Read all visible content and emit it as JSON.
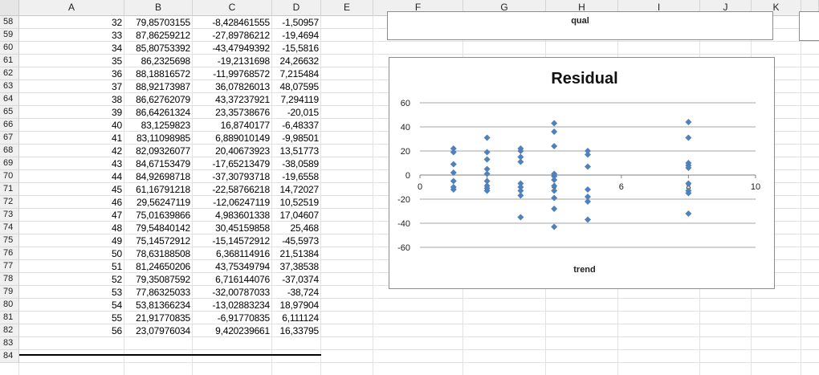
{
  "columns": [
    "A",
    "B",
    "C",
    "D",
    "E",
    "F",
    "G",
    "H",
    "I",
    "J",
    "K"
  ],
  "rows": [
    {
      "num": "58",
      "a": "32",
      "b": "79,85703155",
      "c": "-8,428461555",
      "d": "-1,50957"
    },
    {
      "num": "59",
      "a": "33",
      "b": "87,86259212",
      "c": "-27,89786212",
      "d": "-19,4694"
    },
    {
      "num": "60",
      "a": "34",
      "b": "85,80753392",
      "c": "-43,47949392",
      "d": "-15,5816"
    },
    {
      "num": "61",
      "a": "35",
      "b": "86,2325698",
      "c": "-19,2131698",
      "d": "24,26632"
    },
    {
      "num": "62",
      "a": "36",
      "b": "88,18816572",
      "c": "-11,99768572",
      "d": "7,215484"
    },
    {
      "num": "63",
      "a": "37",
      "b": "88,92173987",
      "c": "36,07826013",
      "d": "48,07595"
    },
    {
      "num": "64",
      "a": "38",
      "b": "86,62762079",
      "c": "43,37237921",
      "d": "7,294119"
    },
    {
      "num": "65",
      "a": "39",
      "b": "86,64261324",
      "c": "23,35738676",
      "d": "-20,015"
    },
    {
      "num": "66",
      "a": "40",
      "b": "83,1259823",
      "c": "16,8740177",
      "d": "-6,48337"
    },
    {
      "num": "67",
      "a": "41",
      "b": "83,11098985",
      "c": "6,889010149",
      "d": "-9,98501"
    },
    {
      "num": "68",
      "a": "42",
      "b": "82,09326077",
      "c": "20,40673923",
      "d": "13,51773"
    },
    {
      "num": "69",
      "a": "43",
      "b": "84,67153479",
      "c": "-17,65213479",
      "d": "-38,0589"
    },
    {
      "num": "70",
      "a": "44",
      "b": "84,92698718",
      "c": "-37,30793718",
      "d": "-19,6558"
    },
    {
      "num": "71",
      "a": "45",
      "b": "61,16791218",
      "c": "-22,58766218",
      "d": "14,72027"
    },
    {
      "num": "72",
      "a": "46",
      "b": "29,56247119",
      "c": "-12,06247119",
      "d": "10,52519"
    },
    {
      "num": "73",
      "a": "47",
      "b": "75,01639866",
      "c": "4,983601338",
      "d": "17,04607"
    },
    {
      "num": "74",
      "a": "48",
      "b": "79,54840142",
      "c": "30,45159858",
      "d": "25,468"
    },
    {
      "num": "75",
      "a": "49",
      "b": "75,14572912",
      "c": "-15,14572912",
      "d": "-45,5973"
    },
    {
      "num": "76",
      "a": "50",
      "b": "78,63188508",
      "c": "6,368114916",
      "d": "21,51384"
    },
    {
      "num": "77",
      "a": "51",
      "b": "81,24650206",
      "c": "43,75349794",
      "d": "37,38538"
    },
    {
      "num": "78",
      "a": "52",
      "b": "79,35087592",
      "c": "6,716144076",
      "d": "-37,0374"
    },
    {
      "num": "79",
      "a": "53",
      "b": "77,86325033",
      "c": "-32,00787033",
      "d": "-38,724"
    },
    {
      "num": "80",
      "a": "54",
      "b": "53,81366234",
      "c": "-13,02883234",
      "d": "18,97904"
    },
    {
      "num": "81",
      "a": "55",
      "b": "21,91770835",
      "c": "-6,91770835",
      "d": "6,111124"
    },
    {
      "num": "82",
      "a": "56",
      "b": "23,07976034",
      "c": "9,420239661",
      "d": "16,33795"
    },
    {
      "num": "83",
      "a": "",
      "b": "",
      "c": "",
      "d": ""
    },
    {
      "num": "84",
      "a": "",
      "b": "",
      "c": "",
      "d": ""
    }
  ],
  "top_chart": {
    "xlabel": "qual"
  },
  "chart_data": {
    "type": "scatter",
    "title": "Residual",
    "xlabel": "trend",
    "ylabel": "",
    "xlim": [
      0,
      10
    ],
    "ylim": [
      -60,
      60
    ],
    "x_ticks": [
      "0",
      "2",
      "4",
      "6",
      "8",
      "10"
    ],
    "y_ticks": [
      "60",
      "40",
      "20",
      "0",
      "-20",
      "-40",
      "-60"
    ],
    "grid": "horizontal",
    "marker_color": "#4f81bd",
    "points": [
      [
        1,
        22
      ],
      [
        1,
        19
      ],
      [
        1,
        9
      ],
      [
        1,
        2
      ],
      [
        1,
        -5
      ],
      [
        1,
        -10
      ],
      [
        1,
        -12
      ],
      [
        2,
        31
      ],
      [
        2,
        19
      ],
      [
        2,
        13
      ],
      [
        2,
        5
      ],
      [
        2,
        1
      ],
      [
        2,
        -5
      ],
      [
        2,
        -9
      ],
      [
        2,
        -11
      ],
      [
        2,
        -13
      ],
      [
        3,
        22
      ],
      [
        3,
        20
      ],
      [
        3,
        15
      ],
      [
        3,
        11
      ],
      [
        3,
        -7
      ],
      [
        3,
        -10
      ],
      [
        3,
        -13
      ],
      [
        3,
        -17
      ],
      [
        3,
        -35
      ],
      [
        4,
        43
      ],
      [
        4,
        36
      ],
      [
        4,
        24
      ],
      [
        4,
        1
      ],
      [
        4,
        -1
      ],
      [
        4,
        -4
      ],
      [
        4,
        -9
      ],
      [
        4,
        -13
      ],
      [
        4,
        -19
      ],
      [
        4,
        -28
      ],
      [
        4,
        -43
      ],
      [
        5,
        20
      ],
      [
        5,
        17
      ],
      [
        5,
        7
      ],
      [
        5,
        -12
      ],
      [
        5,
        -18
      ],
      [
        5,
        -22
      ],
      [
        5,
        -37
      ],
      [
        8,
        44
      ],
      [
        8,
        31
      ],
      [
        8,
        10
      ],
      [
        8,
        8
      ],
      [
        8,
        6
      ],
      [
        8,
        -7
      ],
      [
        8,
        -13
      ],
      [
        8,
        -15
      ],
      [
        8,
        -32
      ]
    ]
  }
}
